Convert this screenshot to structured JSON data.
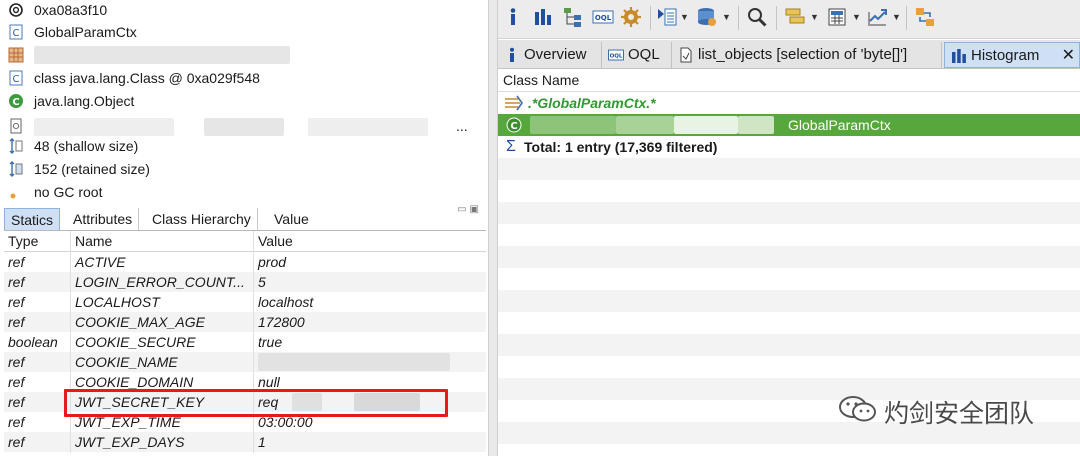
{
  "inspector": {
    "address": "0xa08a3f10",
    "class_name": "GlobalParamCtx",
    "class_ref": "class java.lang.Class @ 0xa029f548",
    "super_class": "java.lang.Object",
    "loader_suffix": "...",
    "shallow_size": "48 (shallow size)",
    "retained_size": "152 (retained size)",
    "gc_root": "no GC root"
  },
  "tabs": [
    "Statics",
    "Attributes",
    "Class Hierarchy",
    "Value"
  ],
  "table": {
    "headers": {
      "type": "Type",
      "name": "Name",
      "value": "Value"
    },
    "rows": [
      {
        "type": "ref",
        "name": "ACTIVE",
        "value": "prod"
      },
      {
        "type": "ref",
        "name": "LOGIN_ERROR_COUNT...",
        "value": "5"
      },
      {
        "type": "ref",
        "name": "LOCALHOST",
        "value": "localhost"
      },
      {
        "type": "ref",
        "name": "COOKIE_MAX_AGE",
        "value": "172800"
      },
      {
        "type": "boolean",
        "name": "COOKIE_SECURE",
        "value": "true"
      },
      {
        "type": "ref",
        "name": "COOKIE_NAME",
        "value": ""
      },
      {
        "type": "ref",
        "name": "COOKIE_DOMAIN",
        "value": "null"
      },
      {
        "type": "ref",
        "name": "JWT_SECRET_KEY",
        "value": "req"
      },
      {
        "type": "ref",
        "name": "JWT_EXP_TIME",
        "value": "03:00:00"
      },
      {
        "type": "ref",
        "name": "JWT_EXP_DAYS",
        "value": "1"
      }
    ]
  },
  "right_tabs": [
    {
      "label": "Overview",
      "icon": "info-icon"
    },
    {
      "label": "OQL",
      "icon": "oql-icon"
    },
    {
      "label": "list_objects  [selection of 'byte[]']",
      "icon": "document-icon"
    },
    {
      "label": "Histogram",
      "icon": "histogram-icon"
    }
  ],
  "histogram": {
    "column_header": "Class Name",
    "filter_row": ".*GlobalParamCtx.*",
    "selected_row_suffix": "GlobalParamCtx",
    "total_row": "Total: 1 entry (17,369 filtered)"
  },
  "watermark": {
    "text": "灼剑安全团队"
  },
  "colors": {
    "highlight_border": "#e21b1b",
    "selection_green": "#56a83a",
    "tab_active": "#cfe0f5",
    "filter_text": "#2f9a2f"
  }
}
